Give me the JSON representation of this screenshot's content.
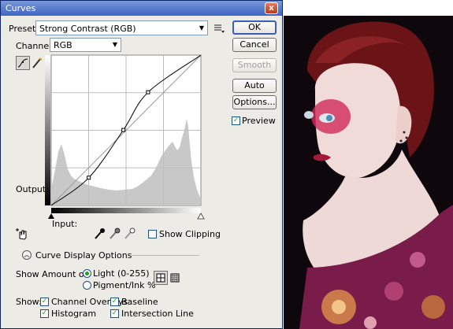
{
  "dialog": {
    "title": "Curves",
    "close_glyph": "x",
    "preset_label": "Preset:",
    "preset_value": "Strong Contrast (RGB)",
    "channel_label": "Channel:",
    "channel_value": "RGB",
    "output_label": "Output:",
    "input_label": "Input:",
    "show_clipping_label": "Show Clipping",
    "curve_display_options_label": "Curve Display Options",
    "show_amount_label": "Show Amount of:",
    "light_label": "Light  (0-255)",
    "pigment_label": "Pigment/Ink %",
    "show_label": "Show:",
    "channel_overlays_label": "Channel Overlays",
    "baseline_label": "Baseline",
    "histogram_label": "Histogram",
    "intersection_line_label": "Intersection Line",
    "preview_label": "Preview"
  },
  "buttons": {
    "ok": "OK",
    "cancel": "Cancel",
    "smooth": "Smooth",
    "auto": "Auto",
    "options": "Options..."
  },
  "state": {
    "show_clipping": false,
    "preview": true,
    "amount_of": "Light  (0-255)",
    "channel_overlays": true,
    "baseline": true,
    "histogram": true,
    "intersection_line": true,
    "grid_mode": "4x4"
  },
  "curve": {
    "input_max": 255,
    "output_max": 255,
    "control_points": [
      [
        0,
        0
      ],
      [
        64,
        47
      ],
      [
        123,
        128
      ],
      [
        165,
        192
      ],
      [
        255,
        255
      ]
    ]
  },
  "colors": {
    "title_bar": "#3d64c4",
    "dialog_bg": "#ecebe6",
    "histogram": "#c8c8c8",
    "curve": "#000000"
  }
}
